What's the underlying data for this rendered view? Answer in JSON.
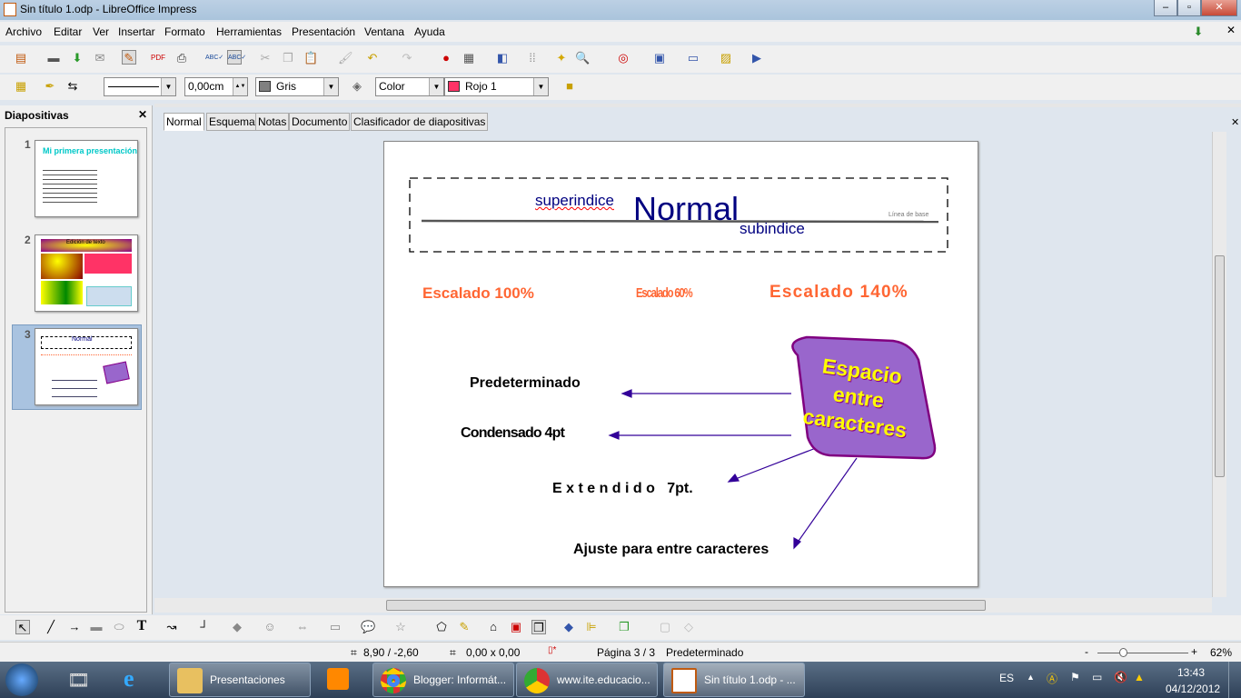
{
  "window": {
    "title": "Sin título 1.odp - LibreOffice Impress",
    "min": "–",
    "max": "▫",
    "close": "✕"
  },
  "menu": [
    "Archivo",
    "Editar",
    "Ver",
    "Insertar",
    "Formato",
    "Herramientas",
    "Presentación",
    "Ventana",
    "Ayuda"
  ],
  "line_toolbar": {
    "line_width": "0,00cm",
    "line_color": "Gris",
    "area_style": "Color",
    "area_color": "Rojo 1"
  },
  "colors": {
    "gris": "#808080",
    "rojo1": "#ff3366",
    "orange_text": "#ff6633",
    "navy_text": "#000080",
    "shape_fill": "#9966cc",
    "shape_border": "#800080",
    "shape_text": "#ffff00",
    "arrow": "#330099",
    "selection": "#a9c3e0"
  },
  "slides_panel": {
    "title": "Diapositivas",
    "close": "✕",
    "slides": [
      {
        "num": "1",
        "title": "Mi primera presentación"
      },
      {
        "num": "2",
        "title": "Edición de texto"
      },
      {
        "num": "3",
        "title": "Normal"
      }
    ],
    "selected": 3
  },
  "view_tabs": [
    "Normal",
    "Esquema",
    "Notas",
    "Documento",
    "Clasificador de diapositivas"
  ],
  "active_tab": "Normal",
  "slide": {
    "superindice": "superindice",
    "normal": "Normal",
    "subindice": "subindice",
    "baseline_label": "Línea de base",
    "scaled_100": "Escalado 100%",
    "scaled_60": "Escalado 60%",
    "scaled_140": "Escalado 140%",
    "default": "Predeterminado",
    "condensed": "Condensado 4pt",
    "extended": "E x t e n d i d o   7pt.",
    "fit": "Ajuste para entre caracteres",
    "shape_text": [
      "Espacio",
      "entre",
      "caracteres"
    ]
  },
  "statusbar": {
    "position": "8,90 / -2,60",
    "size": "0,00 x 0,00",
    "page": "Página 3 / 3",
    "layout": "Predeterminado",
    "zoom": "62%",
    "zoom_minus": "-",
    "zoom_plus": "+"
  },
  "taskbar": {
    "items": [
      {
        "label": "Presentaciones"
      },
      {
        "label": "Blogger: Informát..."
      },
      {
        "label": "www.ite.educacio..."
      },
      {
        "label": "Sin título 1.odp - ..."
      }
    ],
    "lang": "ES",
    "time": "13:43",
    "date": "04/12/2012"
  }
}
